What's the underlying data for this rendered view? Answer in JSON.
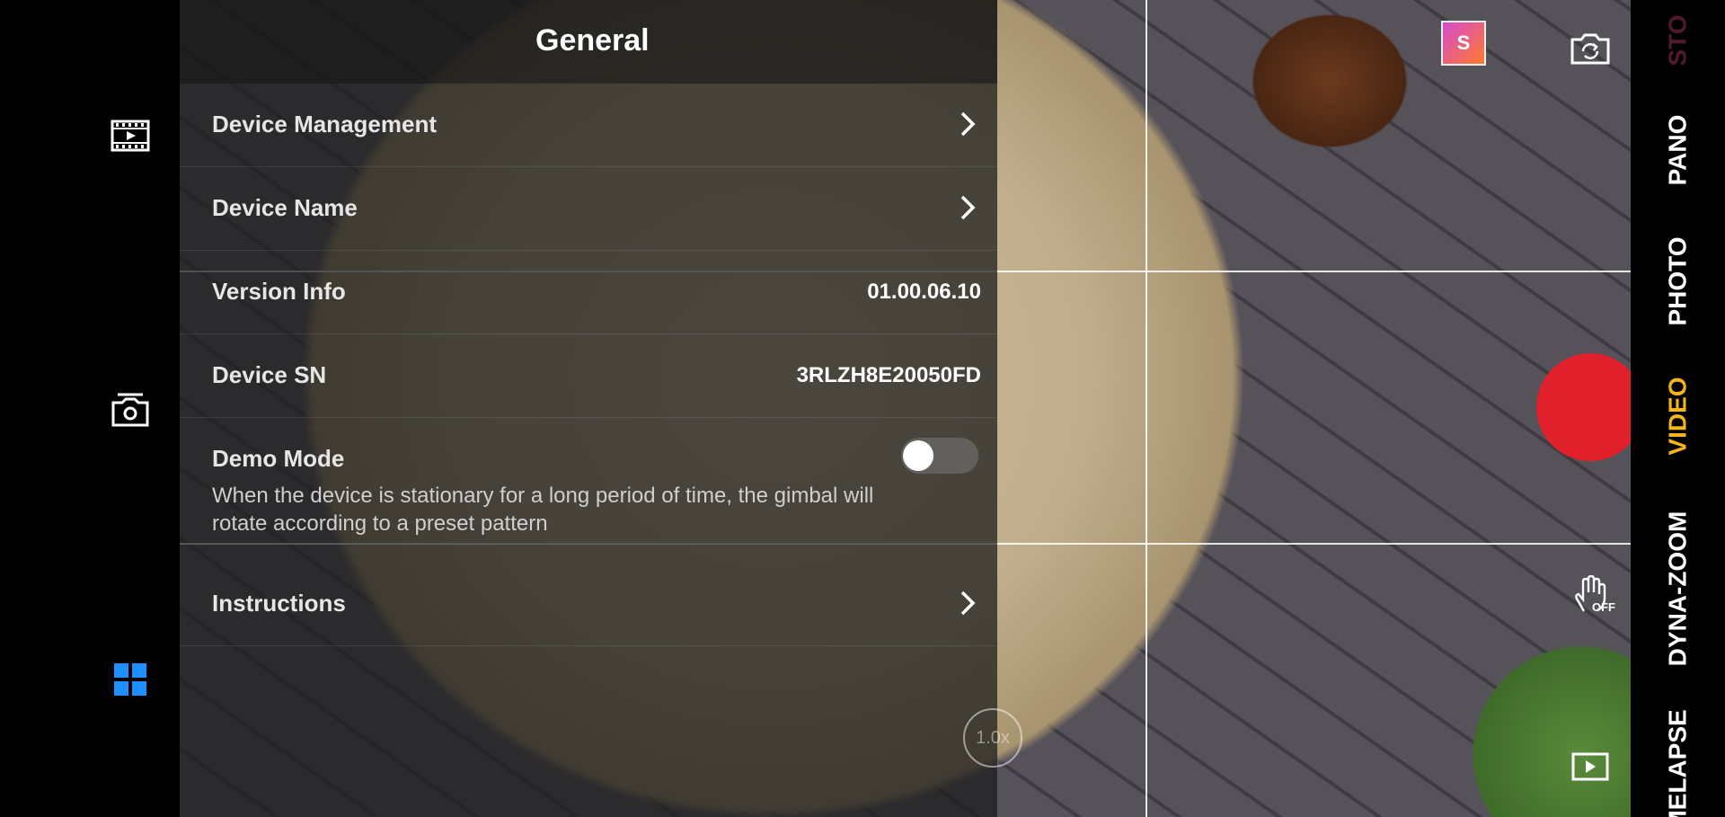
{
  "panel": {
    "title": "General",
    "rows": [
      {
        "label": "Device Management"
      },
      {
        "label": "Device Name"
      },
      {
        "label": "Version Info",
        "value": "01.00.06.10"
      },
      {
        "label": "Device SN",
        "value": "3RLZH8E20050FD"
      },
      {
        "label": "Demo Mode",
        "description": "When the device is stationary for a long period of time, the gimbal will rotate according to a preset pattern",
        "toggle": "off"
      },
      {
        "label": "Instructions"
      }
    ],
    "zoom_label": "1.0x"
  },
  "left_rail": {
    "icons": [
      "film-playback-icon",
      "camera-snapshot-icon",
      "grid-apps-icon"
    ],
    "active_color": "#1e8fff"
  },
  "top_right": {
    "avatar_letter": "S",
    "flip_icon": "camera-flip-icon"
  },
  "modes": {
    "items": [
      "STO",
      "PANO",
      "PHOTO",
      "VIDEO",
      "DYNA-ZOOM",
      "MELAPSE"
    ],
    "active": "VIDEO",
    "active_color": "#f4b41a"
  },
  "controls": {
    "shutter_color": "#e0202a",
    "gesture_label": "OFF"
  }
}
